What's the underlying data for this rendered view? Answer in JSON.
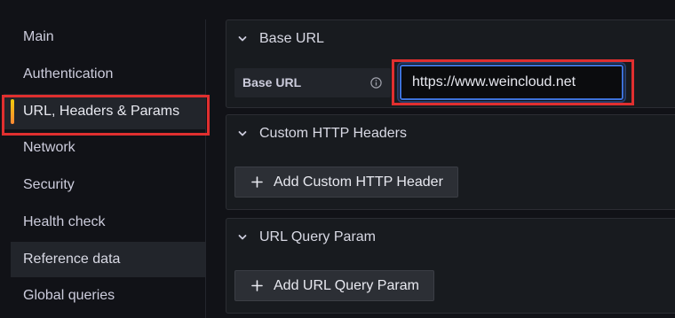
{
  "sidebar": {
    "items": [
      {
        "label": "Main"
      },
      {
        "label": "Authentication"
      },
      {
        "label": "URL, Headers & Params"
      },
      {
        "label": "Network"
      },
      {
        "label": "Security"
      },
      {
        "label": "Health check"
      },
      {
        "label": "Reference data"
      },
      {
        "label": "Global queries"
      }
    ],
    "active_index": 2,
    "hovered_index": 6,
    "active_accent_colors": [
      "#f2cc0c",
      "#ff8833"
    ]
  },
  "sections": {
    "base_url": {
      "title": "Base URL",
      "expanded_icon": "chevron-down-icon",
      "field_label": "Base URL",
      "info_icon": "info-circle-icon",
      "value": "https://www.weincloud.net"
    },
    "custom_headers": {
      "title": "Custom HTTP Headers",
      "expanded_icon": "chevron-down-icon",
      "add_button_label": "Add Custom HTTP Header",
      "add_button_icon": "plus-icon"
    },
    "query_params": {
      "title": "URL Query Param",
      "expanded_icon": "chevron-down-icon",
      "add_button_label": "Add URL Query Param",
      "add_button_icon": "plus-icon"
    }
  },
  "colors": {
    "background": "#111217",
    "panel": "#181b1f",
    "input_focus_border": "#3d71d9",
    "annotation_highlight": "#e02f2f"
  }
}
